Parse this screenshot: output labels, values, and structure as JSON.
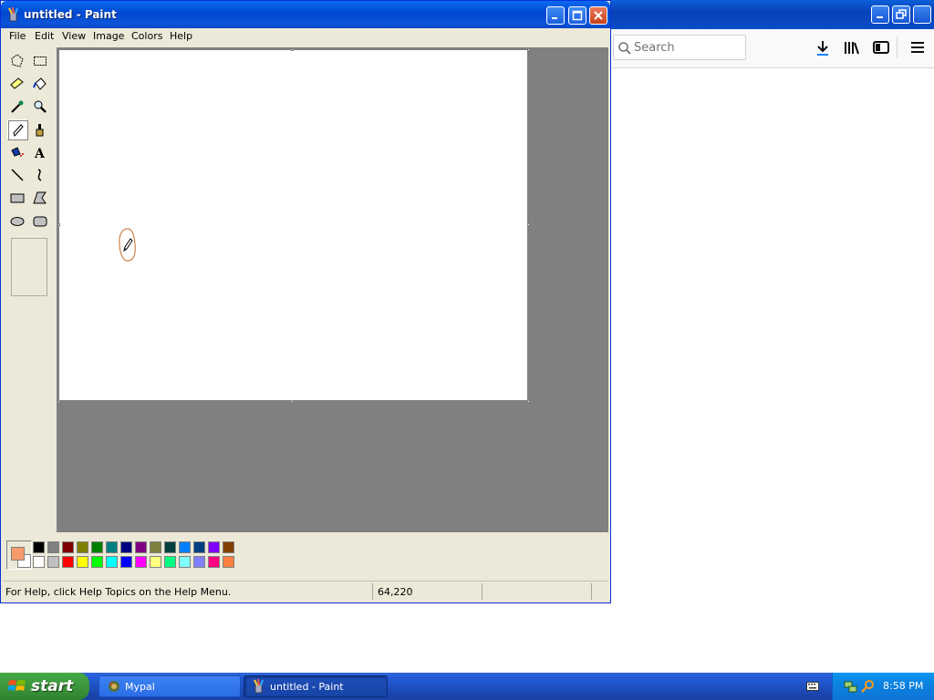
{
  "browser": {
    "search": {
      "placeholder": "Search",
      "value": ""
    },
    "toolbar_icons": [
      "download-icon",
      "library-icon",
      "sidebar-icon",
      "menu-icon"
    ]
  },
  "paint": {
    "title": "untitled - Paint",
    "menu": [
      "File",
      "Edit",
      "View",
      "Image",
      "Colors",
      "Help"
    ],
    "tools": [
      "free-form-select-icon",
      "select-icon",
      "eraser-icon",
      "fill-bucket-icon",
      "pick-color-icon",
      "magnifier-icon",
      "pencil-icon",
      "brush-icon",
      "airbrush-icon",
      "text-icon",
      "line-icon",
      "curve-icon",
      "rectangle-icon",
      "polygon-icon",
      "ellipse-icon",
      "rounded-rectangle-icon"
    ],
    "selected_tool": "pencil-icon",
    "foreground_color": "#f79a6b",
    "background_color": "#ffffff",
    "palette_top": [
      "#000000",
      "#808080",
      "#800000",
      "#808000",
      "#008000",
      "#008080",
      "#000080",
      "#800080",
      "#808040",
      "#004040",
      "#0080ff",
      "#004080",
      "#8000ff",
      "#804000"
    ],
    "palette_bottom": [
      "#ffffff",
      "#c0c0c0",
      "#ff0000",
      "#ffff00",
      "#00ff00",
      "#00ffff",
      "#0000ff",
      "#ff00ff",
      "#ffff80",
      "#00ff80",
      "#80ffff",
      "#8080ff",
      "#ff0080",
      "#ff8040"
    ],
    "status": {
      "help_text": "For Help, click Help Topics on the Help Menu.",
      "coords": "64,220"
    }
  },
  "taskbar": {
    "start_label": "start",
    "tasks": [
      {
        "label": "Mypal",
        "active": false
      },
      {
        "label": "untitled - Paint",
        "active": true
      }
    ],
    "clock": "8:58 PM"
  }
}
